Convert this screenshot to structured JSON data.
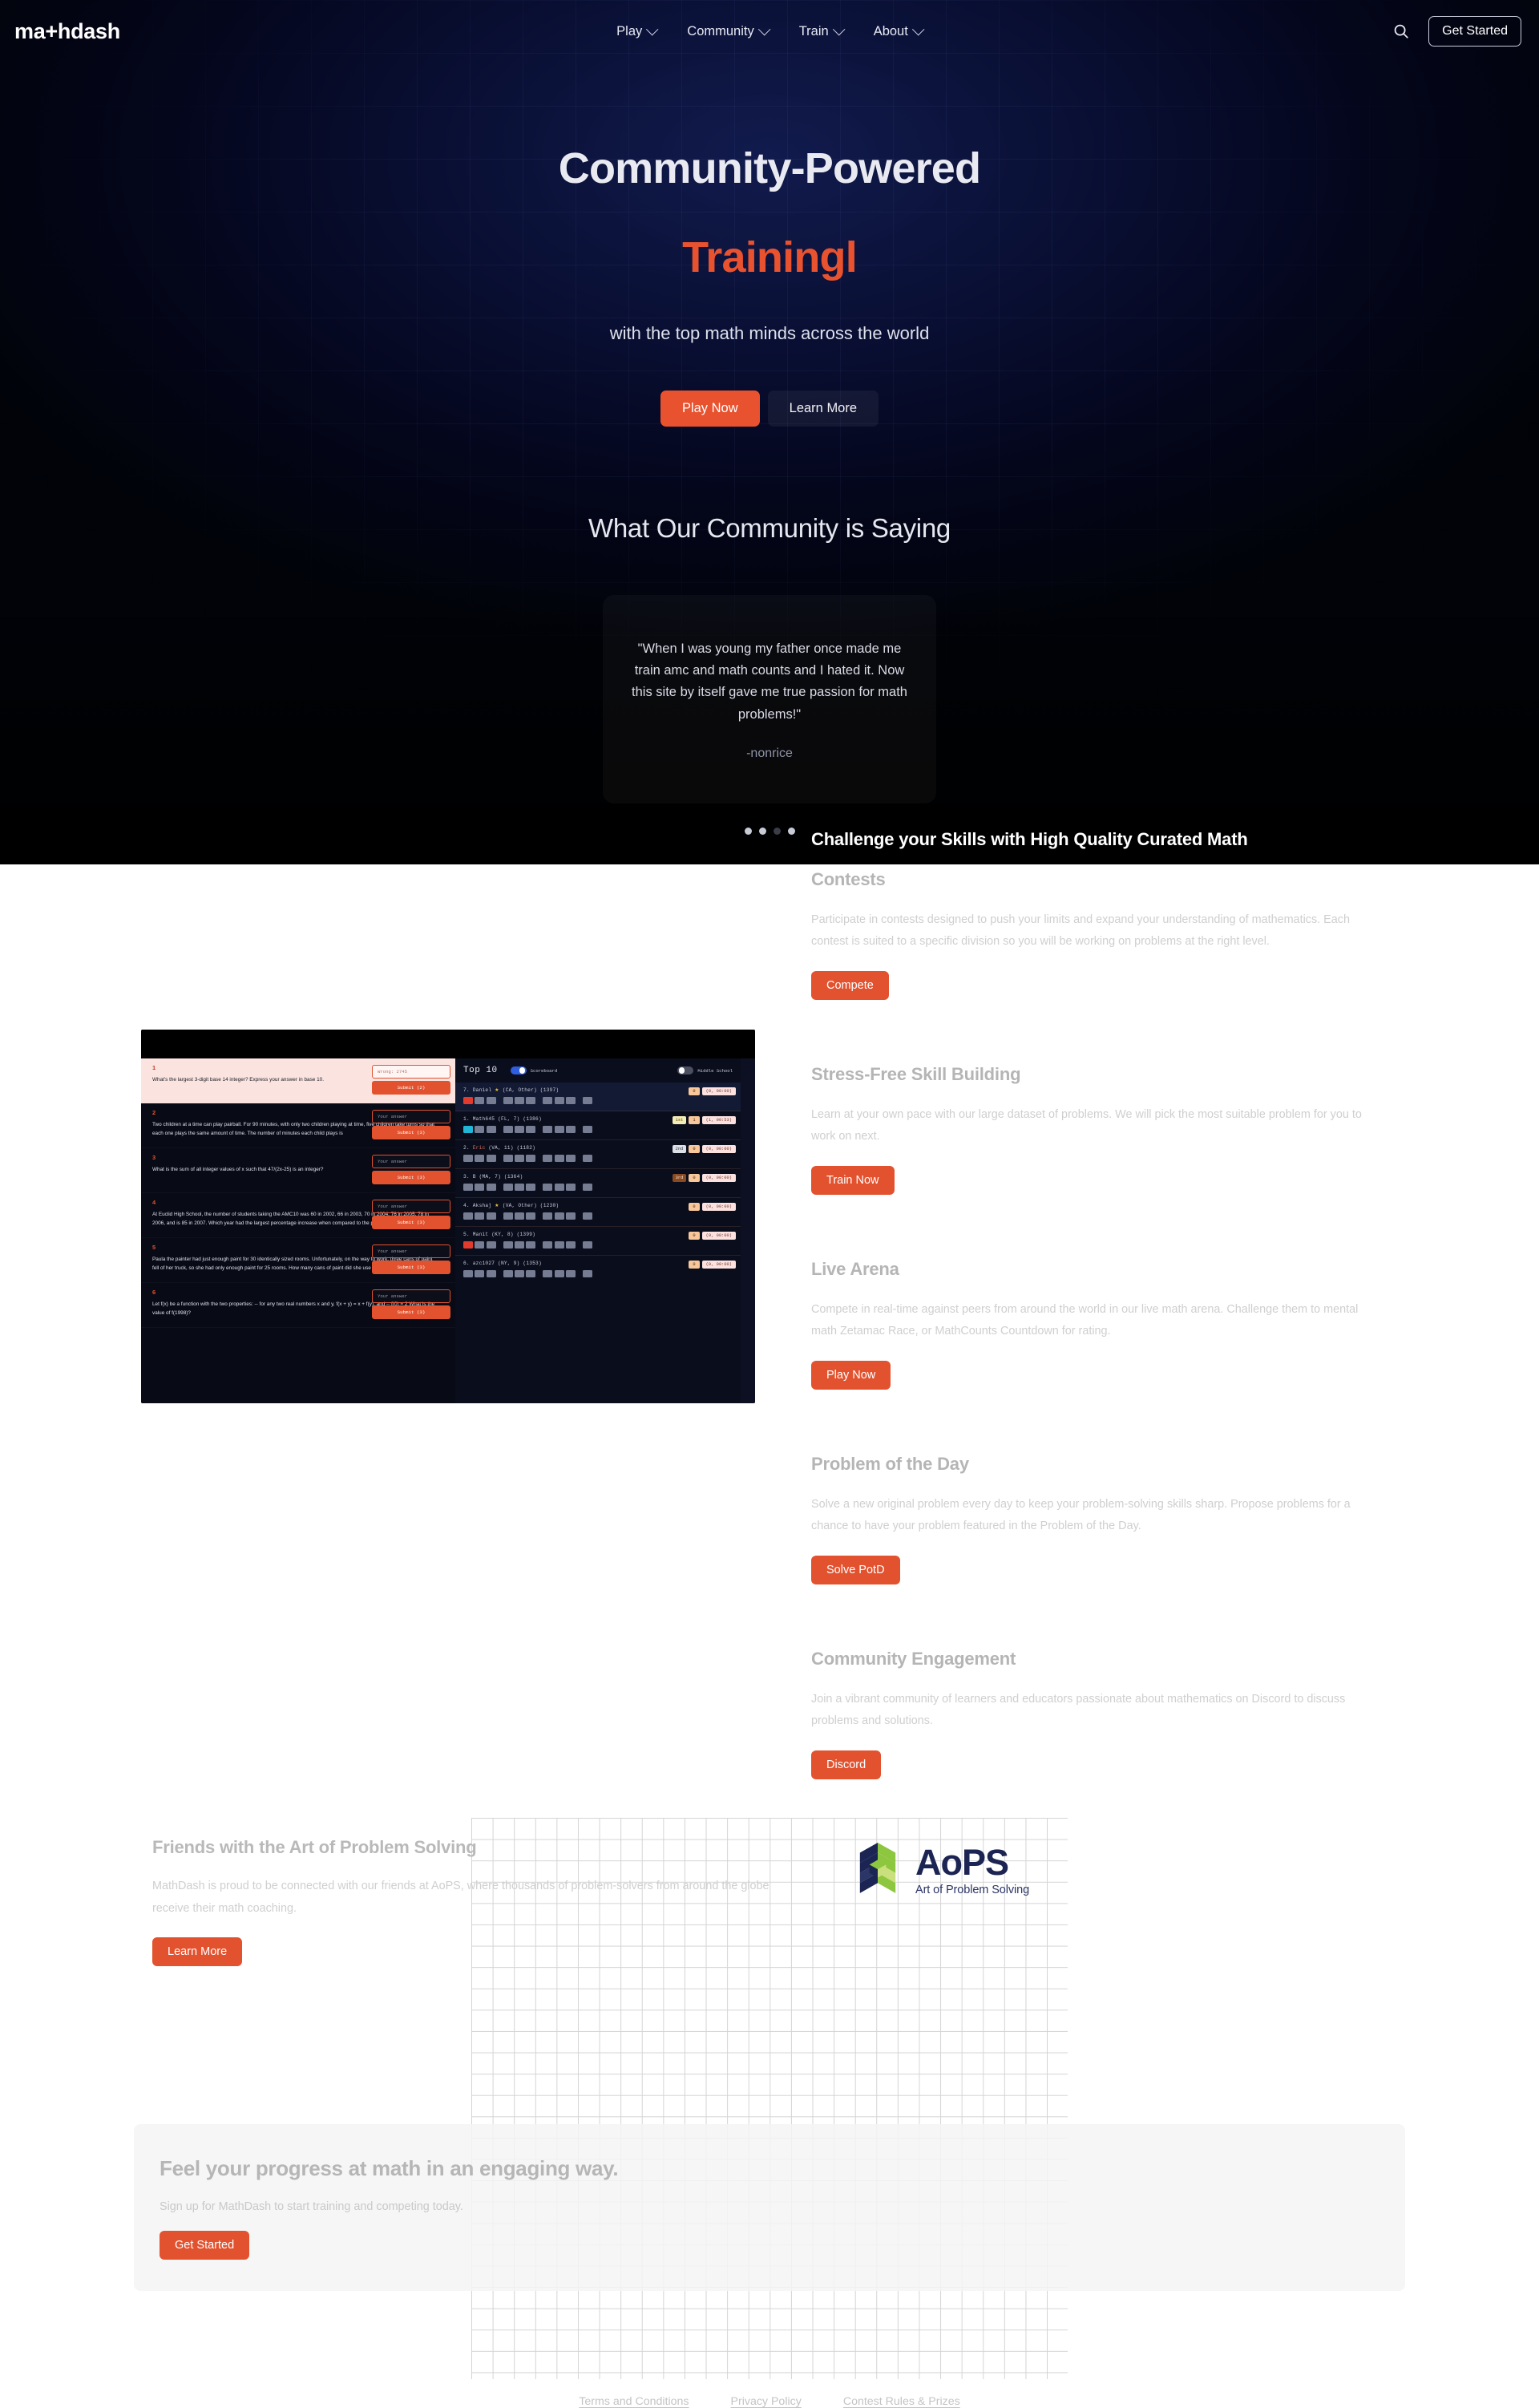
{
  "brand": {
    "logo": "ma+hdash"
  },
  "nav": {
    "items": [
      {
        "label": "Play",
        "icon": "chevron-down-icon"
      },
      {
        "label": "Community",
        "icon": "chevron-down-icon"
      },
      {
        "label": "Train",
        "icon": "chevron-down-icon"
      },
      {
        "label": "About",
        "icon": "chevron-down-icon"
      }
    ],
    "search_icon": "search-icon",
    "get_started": "Get Started"
  },
  "hero": {
    "title_line1": "Community-Powered",
    "title_line2": "Trainingl",
    "subtitle": "with the top math minds across the world",
    "primary_cta": "Play Now",
    "secondary_cta": "Learn More",
    "accent_color": "#e8522f"
  },
  "testimonials": {
    "heading": "What Our Community is Saying",
    "current": {
      "quote": "\"When I was young my father once made me train amc and math counts and I hated it. Now this site by itself gave me true passion for math problems!\"",
      "author": "-nonrice"
    },
    "dots": [
      "active",
      "active",
      "inactive",
      "active"
    ]
  },
  "features": [
    {
      "title": "Challenge your Skills with High Quality Curated Math",
      "title2": "Contests",
      "desc": "Participate in contests designed to push your limits and expand your understanding of mathematics. Each contest is suited to a specific division so you will be working on problems at the right level.",
      "cta": "Compete"
    },
    {
      "title": "Stress-Free Skill Building",
      "desc": "Learn at your own pace with our large dataset of problems. We will pick the most suitable problem for you to work on next.",
      "cta": "Train Now"
    },
    {
      "title": "Live Arena",
      "desc": "Compete in real-time against peers from around the world in our live math arena. Challenge them to mental math Zetamac Race, or MathCounts Countdown for rating.",
      "cta": "Play Now"
    },
    {
      "title": "Problem of the Day",
      "desc": "Solve a new original problem every day to keep your problem-solving skills sharp. Propose problems for a chance to have your problem featured in the Problem of the Day.",
      "cta": "Solve PotD"
    },
    {
      "title": "Community Engagement",
      "desc": "Join a vibrant community of learners and educators passionate about mathematics on Discord to discuss problems and solutions.",
      "cta": "Discord"
    }
  ],
  "app_preview": {
    "problems": [
      {
        "num": "1",
        "text": "What's the largest 3-digit base 14 integer?  Express your answer in base 10.",
        "answer_placeholder": "Wrong: 2745",
        "submit": "Submit (2)",
        "highlight": true,
        "wrong": true
      },
      {
        "num": "2",
        "text": "Two children at a time can play pairball.  For 90 minutes, with only two children playing at time, five children take turns so that each one plays the same amount of time.  The number of minutes each child plays is",
        "answer_placeholder": "Your answer",
        "submit": "Submit (3)"
      },
      {
        "num": "3",
        "text": "What is the sum of all integer values of x such that 47/(2x-25) is an integer?",
        "answer_placeholder": "Your answer",
        "submit": "Submit (3)"
      },
      {
        "num": "4",
        "text": "At Euclid High School, the number of students taking the AMC10 was 60 in 2002, 66 in 2003, 70 in 2004, 76 in 2005, 78 in 2006, and is 85 in 2007. Which year had the largest percentage increase when compared to the previous year?",
        "answer_placeholder": "Your answer",
        "submit": "Submit (3)"
      },
      {
        "num": "5",
        "text": "Paula the painter had just enough paint for 30 identically sized rooms. Unfortunately, on the way to work, three cans of paint fell of her truck, so she had only enough paint for 25 rooms. How many cans of paint did she use for the 25 rooms?",
        "answer_placeholder": "Your answer",
        "submit": "Submit (3)"
      },
      {
        "num": "6",
        "text": "Let f(x) be a function with the two properties: -- for any two real numbers x and y, f(x + y) = x + f(y), and -- f(0) = 2      What is the value of f(1998)?",
        "answer_placeholder": "Your answer",
        "submit": "Submit (3)"
      }
    ],
    "board": {
      "title": "Top 10",
      "toggle_scoreboard": "Scoreboard",
      "toggle_school": "Middle School",
      "rows": [
        {
          "rank": "7.",
          "name": "Daniel",
          "star": true,
          "meta": "(CA, Other)",
          "rating": "(1397)",
          "medal": "",
          "points": "0",
          "time": "(0, 00:00)",
          "first_cell": "red",
          "me": true
        },
        {
          "rank": "1.",
          "name": "Math645",
          "star": false,
          "meta": "(FL, 7)",
          "rating": "(1386)",
          "medal": "1st",
          "points": "1",
          "time": "(1, 00:53)",
          "first_cell": "cyan",
          "me": false
        },
        {
          "rank": "2.",
          "name": "Eric",
          "star": false,
          "meta": "(VA, 11)",
          "rating": "(1182)",
          "medal": "2nd",
          "points": "0",
          "time": "(0, 00:00)",
          "first_cell": "",
          "me": false
        },
        {
          "rank": "3.",
          "name": "B",
          "star": false,
          "meta": "(MA, 7)",
          "rating": "(1364)",
          "medal": "3rd",
          "points": "0",
          "time": "(0, 00:00)",
          "first_cell": "",
          "me": false
        },
        {
          "rank": "4.",
          "name": "Akshaj",
          "star": true,
          "meta": "(VA, Other)",
          "rating": "(1230)",
          "medal": "",
          "points": "0",
          "time": "(0, 00:00)",
          "first_cell": "",
          "me": false
        },
        {
          "rank": "5.",
          "name": "Manit",
          "star": false,
          "meta": "(KY, 8)",
          "rating": "(1399)",
          "medal": "",
          "points": "0",
          "time": "(0, 00:00)",
          "first_cell": "red",
          "me": false
        },
        {
          "rank": "6.",
          "name": "azc1027",
          "star": false,
          "meta": "(NY, 9)",
          "rating": "(1353)",
          "medal": "",
          "points": "0",
          "time": "(0, 00:00)",
          "first_cell": "",
          "me": false
        }
      ]
    }
  },
  "aops": {
    "title": "Friends with the Art of Problem Solving",
    "desc": "MathDash is proud to be connected with our friends at AoPS, where thousands of problem-solvers from around the globe receive their math coaching.",
    "cta": "Learn More",
    "logo_word": "AoPS",
    "logo_tagline": "Art of Problem Solving"
  },
  "cta_section": {
    "title": "Feel your progress at math in an engaging way.",
    "subtitle": "Sign up for MathDash to start training and competing today.",
    "button": "Get Started"
  },
  "footer": {
    "links": [
      "Terms and Conditions",
      "Privacy Policy",
      "Contest Rules & Prizes"
    ]
  }
}
